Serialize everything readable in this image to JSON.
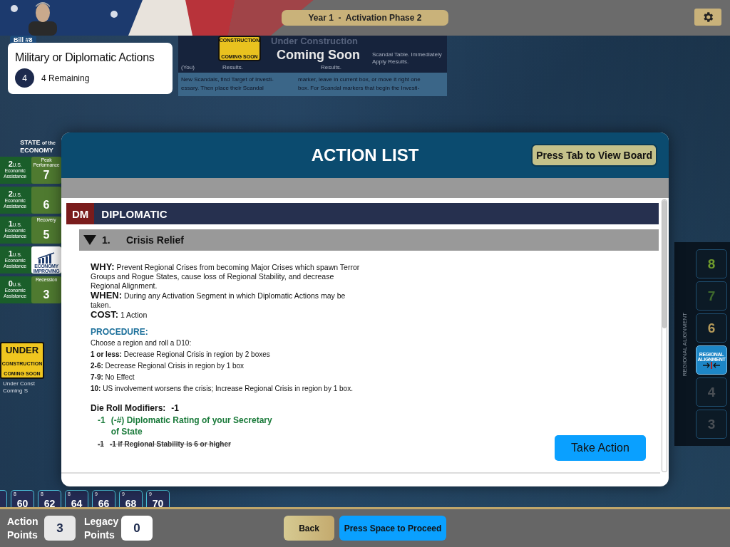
{
  "header": {
    "phase": "Year 1  -  Activation Phase 2"
  },
  "bill_tab": "Bill #8",
  "mission": {
    "title": "Military or Diplomatic Actions",
    "count": "4",
    "remaining": "4 Remaining"
  },
  "scandal_panel": {
    "heading": "Under Construction",
    "overlay": "Coming Soon",
    "sign": [
      "CONSTRUCTION",
      "COMING SOON"
    ],
    "cells": [
      "(You)",
      "Results.",
      "Results.",
      "Scandal Table. Immediately Apply Results."
    ],
    "columns": [
      [
        "New Scandals, find Target of Investi-",
        "essary. Then place their Scandal"
      ],
      [
        "marker, leave in current box, or move it right one",
        "box. For Scandal markers that begin the Investi-"
      ]
    ]
  },
  "economy": {
    "title": "STATE",
    "title_small": "of the",
    "title_word": "ECONOMY",
    "rows": [
      {
        "kind": "box",
        "amount": "2",
        "unit": "U.S.",
        "label": "Economic Assistance",
        "box_label": "Peak Performance",
        "value": "7"
      },
      {
        "kind": "box",
        "amount": "2",
        "unit": "U.S.",
        "label": "Economic Assistance",
        "value": "6"
      },
      {
        "kind": "box",
        "amount": "1",
        "unit": "U.S.",
        "label": "Economic Assistance",
        "box_label": "Recovery",
        "value": "5"
      },
      {
        "kind": "marker",
        "amount": "1",
        "unit": "U.S.",
        "label": "Economic Assistance",
        "marker": "ECONOMY IMPROVING"
      },
      {
        "kind": "box",
        "amount": "0",
        "unit": "U.S.",
        "label": "Economic Assistance",
        "box_label": "Recession",
        "value": "3"
      }
    ]
  },
  "construction_sign": {
    "lines": [
      "UNDER",
      "CONSTRUCTION",
      "COMING SOON"
    ],
    "caption": [
      "Under Const",
      "Coming S"
    ]
  },
  "alignment": {
    "label": "REGIONAL ALIGNMENT",
    "boxes": [
      {
        "kind": "number",
        "value": "8",
        "color": "#6f9a2c"
      },
      {
        "kind": "number",
        "value": "7",
        "color": "#3f6a2c"
      },
      {
        "kind": "number",
        "value": "6",
        "color": "#b59a5a"
      },
      {
        "kind": "marker",
        "value": "REGIONAL ALIGNMENT"
      },
      {
        "kind": "number",
        "value": "4",
        "color": "#4a4f55"
      },
      {
        "kind": "number",
        "value": "3",
        "color": "#4a4f55"
      }
    ]
  },
  "score_track": [
    {
      "small": "8",
      "value": "60"
    },
    {
      "small": "8",
      "value": "62"
    },
    {
      "small": "8",
      "value": "64"
    },
    {
      "small": "9",
      "value": "66"
    },
    {
      "small": "9",
      "value": "68"
    },
    {
      "small": "9",
      "value": "70"
    }
  ],
  "footer": {
    "action_label": "Action Points",
    "action_value": "3",
    "legacy_label": "Legacy Points",
    "legacy_value": "0",
    "back": "Back",
    "proceed": "Press Space to Proceed"
  },
  "modal": {
    "title": "ACTION LIST",
    "view_board": "Press Tab to View Board",
    "section": {
      "code": "DM",
      "title": "DIPLOMATIC"
    },
    "action": {
      "number": "1.",
      "title": "Crisis Relief",
      "expanded": true,
      "details": [
        {
          "label": "WHY:",
          "text": "Prevent Regional Crises from becoming Major Crises which spawn Terror Groups and Rogue States, cause loss of Regional Stability, and decrease Regional Alignment."
        },
        {
          "label": "WHEN:",
          "text": "During any Activation Segment in which Diplomatic Actions may be taken."
        },
        {
          "label": "COST:",
          "text": "1 Action"
        }
      ],
      "procedure_title": "PROCEDURE:",
      "procedure": [
        "Choose a region and roll a D10:",
        "**1 or less:** Decrease Regional Crisis in region by 2 boxes",
        "**2-6:** Decrease Regional Crisis in region by 1 box",
        "**7-9:** No Effect",
        "**10:** US involvement worsens the crisis; Increase Regional Crisis in region by 1 box."
      ],
      "modifiers_title": "Die Roll Modifiers:",
      "modifiers_total": "-1",
      "modifiers": [
        {
          "value": "-1",
          "text": "(-#) Diplomatic Rating of your Secretary of State",
          "active": true
        },
        {
          "value": "-1",
          "text": "-1 if Regional Stability is 6 or higher",
          "active": false
        }
      ]
    },
    "take_action": "Take Action"
  }
}
